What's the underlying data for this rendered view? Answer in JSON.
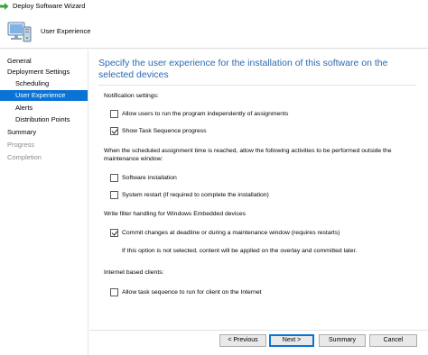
{
  "window": {
    "title": "Deploy Software Wizard"
  },
  "header": {
    "label": "User Experience"
  },
  "nav": {
    "items": [
      {
        "label": "General",
        "state": "normal",
        "level": 0
      },
      {
        "label": "Deployment Settings",
        "state": "normal",
        "level": 0
      },
      {
        "label": "Scheduling",
        "state": "normal",
        "level": 1
      },
      {
        "label": "User Experience",
        "state": "active",
        "level": 1
      },
      {
        "label": "Alerts",
        "state": "normal",
        "level": 1
      },
      {
        "label": "Distribution Points",
        "state": "normal",
        "level": 1
      },
      {
        "label": "Summary",
        "state": "normal",
        "level": 0
      },
      {
        "label": "Progress",
        "state": "disabled",
        "level": 0
      },
      {
        "label": "Completion",
        "state": "disabled",
        "level": 0
      }
    ]
  },
  "main": {
    "title": "Specify the user experience for the installation of this software on the selected devices",
    "notification": {
      "heading": "Notification settings:",
      "options": [
        {
          "label": "Allow users to run the program independently of assignments",
          "checked": false
        },
        {
          "label": "Show Task Sequence progress",
          "checked": true
        }
      ]
    },
    "maintenance": {
      "heading": "When the scheduled assignment time is reached, allow the following activities to be performed outside the maintenance window:",
      "options": [
        {
          "label": "Software installation",
          "checked": false
        },
        {
          "label": "System restart (if required to complete the installation)",
          "checked": false
        }
      ]
    },
    "write_filter": {
      "heading": "Write filter handling for Windows Embedded devices",
      "options": [
        {
          "label": "Commit changes at deadline or during a maintenance window (requires restarts)",
          "checked": true
        }
      ],
      "note": "If this option is not selected, content will be applied on the overlay and committed later."
    },
    "internet": {
      "heading": "Internet based clients:",
      "options": [
        {
          "label": "Allow task sequence to run for client on the Internet",
          "checked": false
        }
      ]
    }
  },
  "buttons": {
    "previous": "< Previous",
    "next": "Next >",
    "summary": "Summary",
    "cancel": "Cancel"
  },
  "colors": {
    "accent": "#0a74d6",
    "title_text": "#2a6ab0",
    "disabled_text": "#8a8a8a",
    "icon_green": "#3aa33a"
  }
}
